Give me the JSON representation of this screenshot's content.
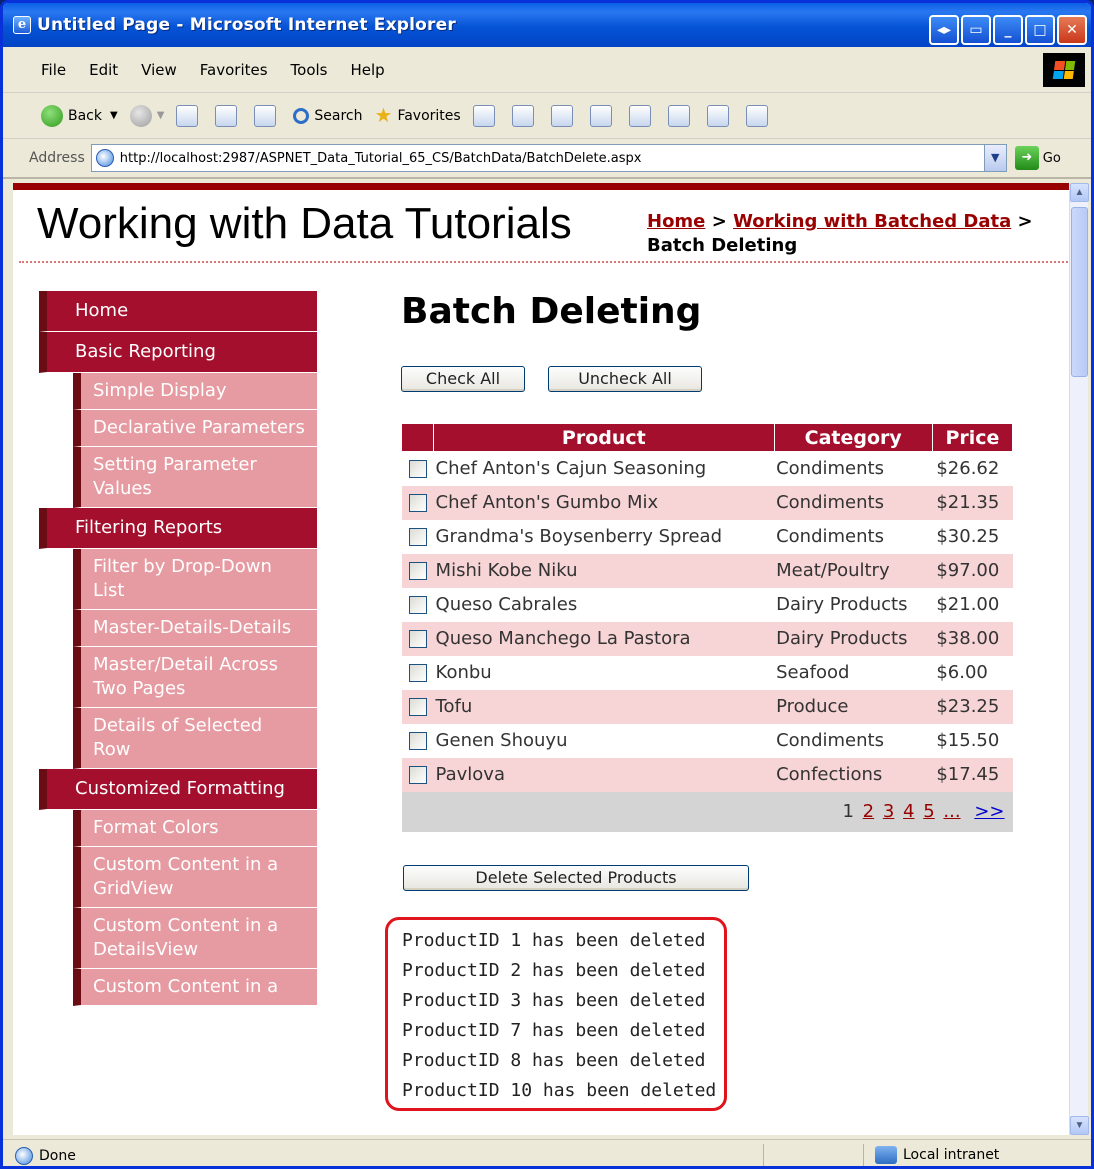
{
  "window": {
    "title": "Untitled Page - Microsoft Internet Explorer"
  },
  "menubar": {
    "items": [
      "File",
      "Edit",
      "View",
      "Favorites",
      "Tools",
      "Help"
    ]
  },
  "toolbar": {
    "back": "Back",
    "search": "Search",
    "favorites": "Favorites"
  },
  "address": {
    "label": "Address",
    "url": "http://localhost:2987/ASPNET_Data_Tutorial_65_CS/BatchData/BatchDelete.aspx",
    "go": "Go"
  },
  "header": {
    "title": "Working with Data Tutorials",
    "breadcrumb": {
      "home": "Home",
      "section": "Working with Batched Data",
      "separator": ">",
      "current": "Batch Deleting"
    }
  },
  "sidemenu": {
    "home": "Home",
    "basic_reporting": "Basic Reporting",
    "simple_display": "Simple Display",
    "declarative_parameters": "Declarative Parameters",
    "setting_parameter_values": "Setting Parameter Values",
    "filtering_reports": "Filtering Reports",
    "filter_by_dropdown": "Filter by Drop-Down List",
    "master_details_details": "Master-Details-Details",
    "master_detail_two_pages": "Master/Detail Across Two Pages",
    "details_selected_row": "Details of Selected Row",
    "customized_formatting": "Customized Formatting",
    "format_colors": "Format Colors",
    "custom_content_gridview": "Custom Content in a GridView",
    "custom_content_detailsview": "Custom Content in a DetailsView",
    "custom_content_partial": "Custom Content in a"
  },
  "main": {
    "title": "Batch Deleting",
    "check_all": "Check All",
    "uncheck_all": "Uncheck All",
    "delete_button": "Delete Selected Products"
  },
  "grid": {
    "headers": {
      "product": "Product",
      "category": "Category",
      "price": "Price"
    },
    "rows": [
      {
        "product": "Chef Anton's Cajun Seasoning",
        "category": "Condiments",
        "price": "$26.62"
      },
      {
        "product": "Chef Anton's Gumbo Mix",
        "category": "Condiments",
        "price": "$21.35"
      },
      {
        "product": "Grandma's Boysenberry Spread",
        "category": "Condiments",
        "price": "$30.25"
      },
      {
        "product": "Mishi Kobe Niku",
        "category": "Meat/Poultry",
        "price": "$97.00"
      },
      {
        "product": "Queso Cabrales",
        "category": "Dairy Products",
        "price": "$21.00"
      },
      {
        "product": "Queso Manchego La Pastora",
        "category": "Dairy Products",
        "price": "$38.00"
      },
      {
        "product": "Konbu",
        "category": "Seafood",
        "price": "$6.00"
      },
      {
        "product": "Tofu",
        "category": "Produce",
        "price": "$23.25"
      },
      {
        "product": "Genen Shouyu",
        "category": "Condiments",
        "price": "$15.50"
      },
      {
        "product": "Pavlova",
        "category": "Confections",
        "price": "$17.45"
      }
    ],
    "pager": {
      "current": "1",
      "pages": [
        "2",
        "3",
        "4",
        "5",
        "..."
      ],
      "next": ">>"
    }
  },
  "messages": [
    "ProductID 1 has been deleted",
    "ProductID 2 has been deleted",
    "ProductID 3 has been deleted",
    "ProductID 7 has been deleted",
    "ProductID 8 has been deleted",
    "ProductID 10 has been deleted"
  ],
  "status": {
    "text": "Done",
    "zone": "Local intranet"
  }
}
